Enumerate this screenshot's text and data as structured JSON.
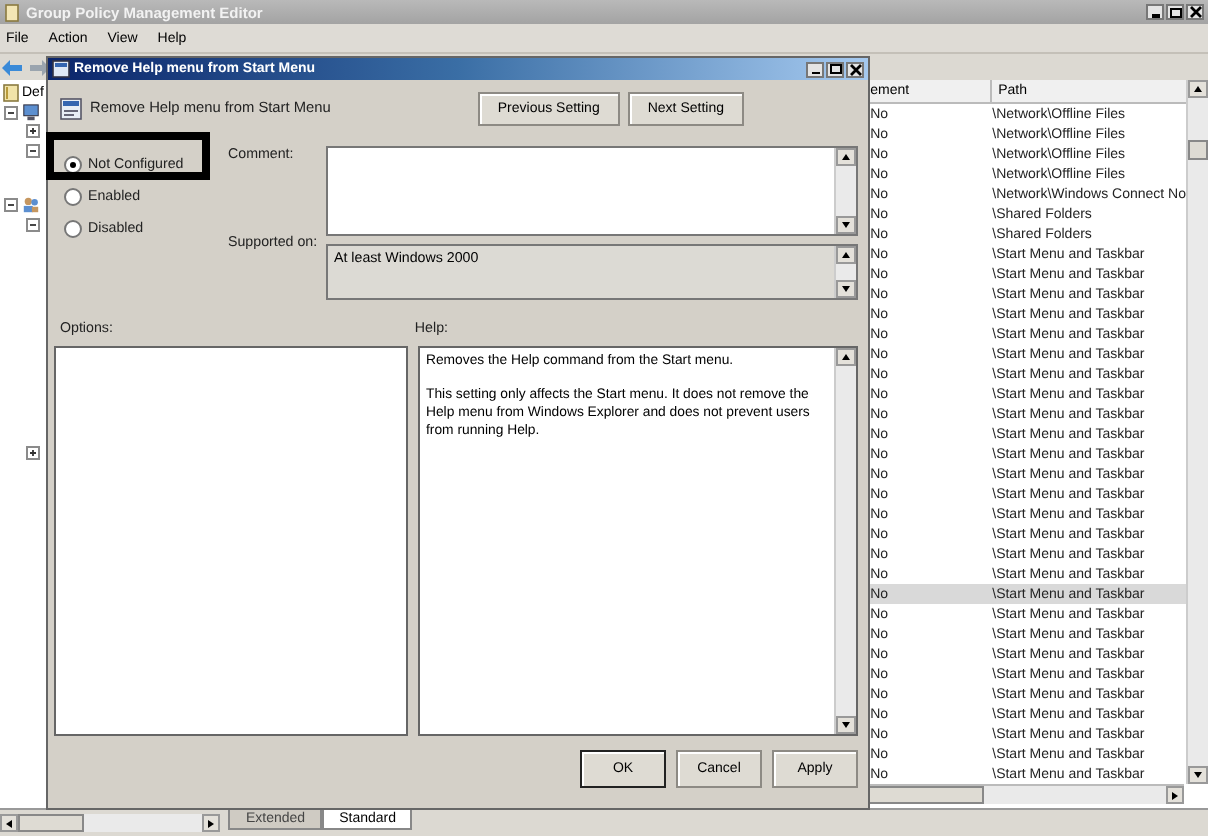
{
  "window": {
    "title": "Group Policy Management Editor"
  },
  "menu": [
    "File",
    "Action",
    "View",
    "Help"
  ],
  "tree": {
    "label": "Def",
    "children": [
      {
        "kind": "computer",
        "expanded": true,
        "children": [
          {
            "expanded": false
          },
          {
            "expanded": true
          }
        ]
      },
      {
        "kind": "users",
        "expanded": true,
        "children": [
          {
            "expanded": true
          },
          {
            "expanded": false
          }
        ]
      }
    ]
  },
  "list": {
    "columns": [
      "ement",
      "Path"
    ],
    "rows": [
      {
        "cells": [
          "No",
          "\\Network\\Offline Files"
        ],
        "selected": false
      },
      {
        "cells": [
          "No",
          "\\Network\\Offline Files"
        ],
        "selected": false
      },
      {
        "cells": [
          "No",
          "\\Network\\Offline Files"
        ],
        "selected": false
      },
      {
        "cells": [
          "No",
          "\\Network\\Offline Files"
        ],
        "selected": false
      },
      {
        "cells": [
          "No",
          "\\Network\\Windows Connect No"
        ],
        "selected": false
      },
      {
        "cells": [
          "No",
          "\\Shared Folders"
        ],
        "selected": false
      },
      {
        "cells": [
          "No",
          "\\Shared Folders"
        ],
        "selected": false
      },
      {
        "cells": [
          "No",
          "\\Start Menu and Taskbar"
        ],
        "selected": false
      },
      {
        "cells": [
          "No",
          "\\Start Menu and Taskbar"
        ],
        "selected": false
      },
      {
        "cells": [
          "No",
          "\\Start Menu and Taskbar"
        ],
        "selected": false
      },
      {
        "cells": [
          "No",
          "\\Start Menu and Taskbar"
        ],
        "selected": false
      },
      {
        "cells": [
          "No",
          "\\Start Menu and Taskbar"
        ],
        "selected": false
      },
      {
        "cells": [
          "No",
          "\\Start Menu and Taskbar"
        ],
        "selected": false
      },
      {
        "cells": [
          "No",
          "\\Start Menu and Taskbar"
        ],
        "selected": false
      },
      {
        "cells": [
          "No",
          "\\Start Menu and Taskbar"
        ],
        "selected": false
      },
      {
        "cells": [
          "No",
          "\\Start Menu and Taskbar"
        ],
        "selected": false
      },
      {
        "cells": [
          "No",
          "\\Start Menu and Taskbar"
        ],
        "selected": false
      },
      {
        "cells": [
          "No",
          "\\Start Menu and Taskbar"
        ],
        "selected": false
      },
      {
        "cells": [
          "No",
          "\\Start Menu and Taskbar"
        ],
        "selected": false
      },
      {
        "cells": [
          "No",
          "\\Start Menu and Taskbar"
        ],
        "selected": false
      },
      {
        "cells": [
          "No",
          "\\Start Menu and Taskbar"
        ],
        "selected": false
      },
      {
        "cells": [
          "No",
          "\\Start Menu and Taskbar"
        ],
        "selected": false
      },
      {
        "cells": [
          "No",
          "\\Start Menu and Taskbar"
        ],
        "selected": false
      },
      {
        "cells": [
          "No",
          "\\Start Menu and Taskbar"
        ],
        "selected": false
      },
      {
        "cells": [
          "No",
          "\\Start Menu and Taskbar"
        ],
        "selected": true
      },
      {
        "cells": [
          "No",
          "\\Start Menu and Taskbar"
        ],
        "selected": false
      },
      {
        "cells": [
          "No",
          "\\Start Menu and Taskbar"
        ],
        "selected": false
      },
      {
        "cells": [
          "No",
          "\\Start Menu and Taskbar"
        ],
        "selected": false
      },
      {
        "cells": [
          "No",
          "\\Start Menu and Taskbar"
        ],
        "selected": false
      },
      {
        "cells": [
          "No",
          "\\Start Menu and Taskbar"
        ],
        "selected": false
      },
      {
        "cells": [
          "No",
          "\\Start Menu and Taskbar"
        ],
        "selected": false
      },
      {
        "cells": [
          "No",
          "\\Start Menu and Taskbar"
        ],
        "selected": false
      },
      {
        "cells": [
          "No",
          "\\Start Menu and Taskbar"
        ],
        "selected": false
      },
      {
        "cells": [
          "No",
          "\\Start Menu and Taskbar"
        ],
        "selected": false
      }
    ]
  },
  "view_tabs": [
    {
      "label": "Extended",
      "selected": false
    },
    {
      "label": "Standard",
      "selected": true
    }
  ],
  "dialog": {
    "title": "Remove Help menu from Start Menu",
    "setting_name": "Remove Help menu from Start Menu",
    "nav_buttons": [
      "Previous Setting",
      "Next Setting"
    ],
    "options": [
      {
        "label": "Not Configured",
        "selected": true
      },
      {
        "label": "Enabled",
        "selected": false
      },
      {
        "label": "Disabled",
        "selected": false
      }
    ],
    "comment_label": "Comment:",
    "supported_label": "Supported on:",
    "supported_value": "At least Windows 2000",
    "options_label": "Options:",
    "help_label": "Help:",
    "help_paragraphs": [
      "Removes the Help command from the Start menu.",
      "This setting only affects the Start menu. It does not remove the Help menu from Windows Explorer and does not prevent users from running Help."
    ],
    "buttons": [
      "OK",
      "Cancel",
      "Apply"
    ]
  }
}
